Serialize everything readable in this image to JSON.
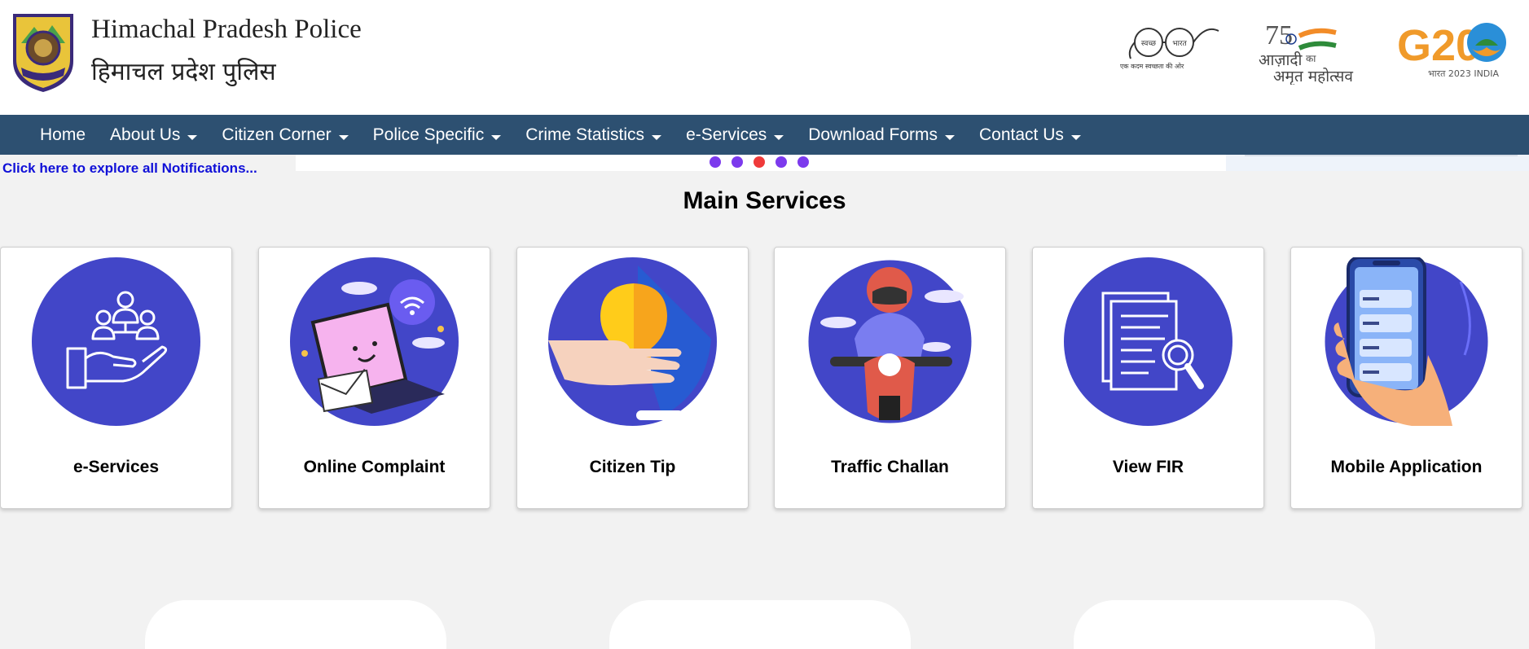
{
  "header": {
    "title_en": "Himachal Pradesh Police",
    "title_hi": "हिमाचल प्रदेश पुलिस",
    "partners": [
      {
        "name": "swachh-bharat-logo",
        "text_1": "स्वच्छ",
        "text_2": "भारत",
        "tagline": "एक कदम स्वच्छता की ओर"
      },
      {
        "name": "azadi-ka-amrit-mahotsav-logo",
        "number": "75",
        "text_1": "आज़ादी",
        "text_2": "का",
        "text_3": "अमृत महोत्सव"
      },
      {
        "name": "g20-logo",
        "text": "G20",
        "sub": "भारत 2023 INDIA"
      }
    ]
  },
  "nav": {
    "items": [
      {
        "label": "Home",
        "dropdown": false
      },
      {
        "label": "About Us",
        "dropdown": true
      },
      {
        "label": "Citizen Corner",
        "dropdown": true
      },
      {
        "label": "Police Specific",
        "dropdown": true
      },
      {
        "label": "Crime Statistics",
        "dropdown": true
      },
      {
        "label": "e-Services",
        "dropdown": true
      },
      {
        "label": "Download Forms",
        "dropdown": true
      },
      {
        "label": "Contact Us",
        "dropdown": true
      }
    ]
  },
  "notifications": {
    "link_text": "Click here to explore all Notifications..."
  },
  "slider": {
    "dot_count": 5,
    "active_index": 2
  },
  "main_services": {
    "title": "Main Services",
    "cards": [
      {
        "label": "e-Services",
        "icon": "eservices-hand-people-icon"
      },
      {
        "label": "Online Complaint",
        "icon": "online-complaint-laptop-icon"
      },
      {
        "label": "Citizen Tip",
        "icon": "citizen-tip-lightbulb-icon"
      },
      {
        "label": "Traffic Challan",
        "icon": "traffic-challan-scooter-icon"
      },
      {
        "label": "View FIR",
        "icon": "view-fir-document-icon"
      },
      {
        "label": "Mobile Application",
        "icon": "mobile-application-phone-icon"
      }
    ]
  },
  "colors": {
    "nav_bg": "#2d5071",
    "circle_bg": "#4246c8",
    "link": "#1010d8",
    "dot": "#7c3aed",
    "dot_active": "#ef3a3a",
    "page_bg": "#f2f2f2"
  }
}
